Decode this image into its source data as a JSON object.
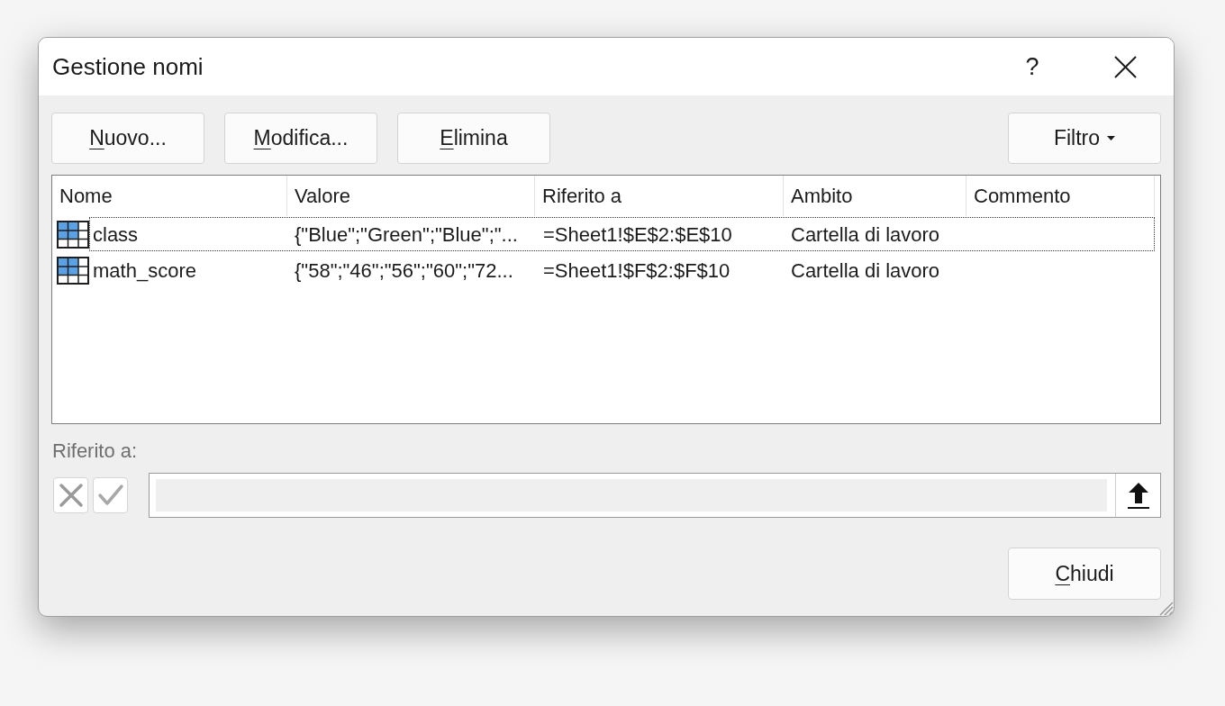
{
  "title_bar": {
    "title": "Gestione nomi",
    "help": "?"
  },
  "toolbar": [
    {
      "label": "Nuovo...",
      "kind": "push",
      "access_key_underlined": true
    },
    {
      "label": "Modifica...",
      "kind": "push",
      "access_key_underlined": true
    },
    {
      "label": "Elimina",
      "kind": "push",
      "access_key_underlined": true
    },
    {
      "label": "Filtro",
      "kind": "dropdown",
      "access_key_underlined": false
    }
  ],
  "names_list": {
    "columns": [
      "Nome",
      "Valore",
      "Riferito a",
      "Ambito",
      "Commento"
    ],
    "rows": [
      {
        "name": "class",
        "value": "{\"Blue\";\"Green\";\"Blue\";\"...",
        "refers_to": "=Sheet1!$E$2:$E$10",
        "scope": "Cartella di lavoro",
        "selected": true
      },
      {
        "name": "math_score",
        "value": "{\"58\";\"46\";\"56\";\"60\";\"72...",
        "refers_to": "=Sheet1!$F$2:$F$10",
        "scope": "Cartella di lavoro",
        "selected": false
      }
    ]
  },
  "reference_editor": {
    "label": "Riferito a:",
    "disabled": true
  },
  "close_button": {
    "label": "Chiudi",
    "access_key_underlined": true
  }
}
